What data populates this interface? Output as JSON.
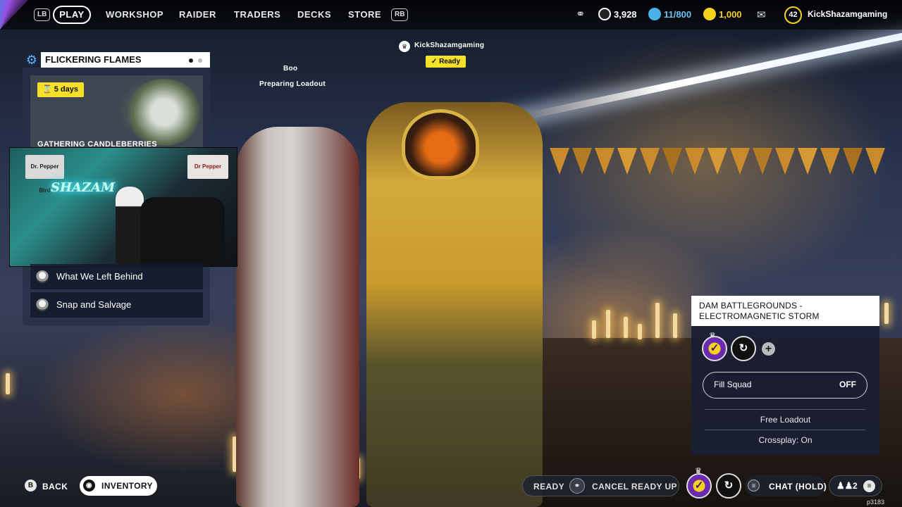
{
  "topbar": {
    "lb": "LB",
    "rb": "RB",
    "nav": [
      {
        "label": "PLAY",
        "active": true
      },
      {
        "label": "WORKSHOP"
      },
      {
        "label": "RAIDER"
      },
      {
        "label": "TRADERS"
      },
      {
        "label": "DECKS"
      },
      {
        "label": "STORE"
      }
    ],
    "currency_coins": "3,928",
    "currency_storage": "11/800",
    "currency_cred": "1,000",
    "level": "42",
    "username": "KickShazamgaming"
  },
  "event": {
    "title": "FLICKERING FLAMES",
    "days": "5 days",
    "image_title": "GATHERING CANDLEBERRIES",
    "quests": [
      "What We Left Behind",
      "Snap and Salvage"
    ]
  },
  "webcam": {
    "neon_text": "SHAZAM",
    "posters": [
      "Dr. Pepper Bird",
      "Dr Pepper"
    ]
  },
  "squad": {
    "leader_name": "KickShazamgaming",
    "leader_status": "Ready",
    "member_name": "Boo",
    "member_status": "Preparing Loadout"
  },
  "match": {
    "map_line1": "DAM BATTLEGROUNDS -",
    "map_line2": "ELECTROMAGNETIC STORM",
    "fill_squad_label": "Fill Squad",
    "fill_squad_value": "OFF",
    "loadout": "Free Loadout",
    "crossplay": "Crossplay: On"
  },
  "bottom": {
    "back_glyph": "B",
    "back_label": "BACK",
    "inventory_label": "INVENTORY",
    "ready_label": "READY",
    "cancel_label": "CANCEL READY UP",
    "chat_label": "CHAT (HOLD)",
    "party_count": "2",
    "version": "p3183"
  },
  "colors": {
    "accent_yellow": "#f5e12a",
    "accent_blue": "#5bb4ff",
    "panel_dark": "#1a1e34"
  }
}
